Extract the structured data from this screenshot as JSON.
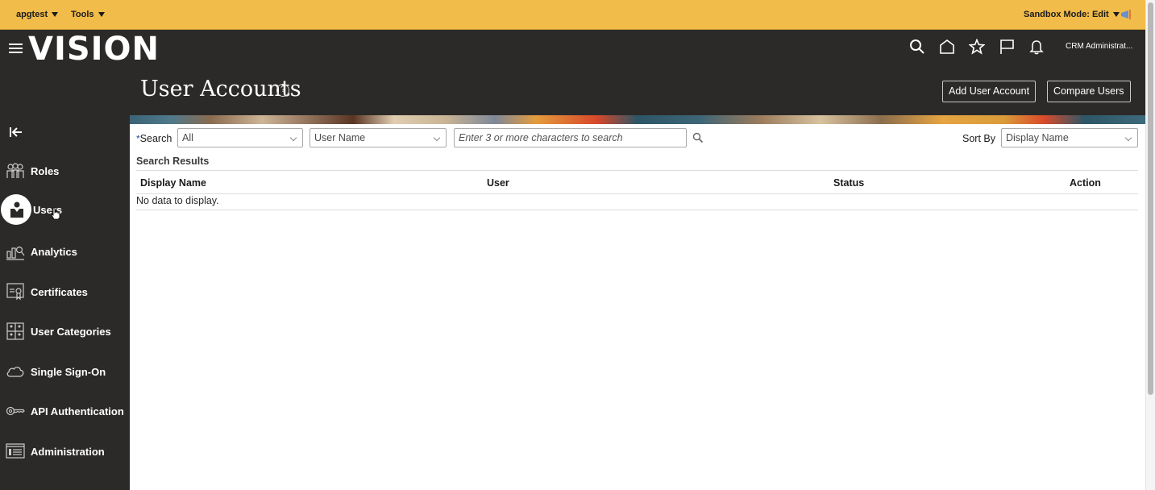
{
  "topbar": {
    "account_menu": "apgtest",
    "tools_menu": "Tools",
    "sandbox_mode": "Sandbox Mode: Edit"
  },
  "header": {
    "logo": "VISION",
    "user_menu": "CRM Administrat...",
    "icons": [
      "search-icon",
      "home-icon",
      "favorites-star-icon",
      "flag-icon",
      "notifications-bell-icon"
    ]
  },
  "page": {
    "title": "User Accounts",
    "help": "?",
    "add_user_account": "Add User Account",
    "compare_users": "Compare Users"
  },
  "sidebar": {
    "items": [
      {
        "label": "Roles",
        "icon": "roles-icon",
        "active": false
      },
      {
        "label": "Users",
        "icon": "user-icon",
        "active": true
      },
      {
        "label": "Analytics",
        "icon": "analytics-icon",
        "active": false
      },
      {
        "label": "Certificates",
        "icon": "certificate-icon",
        "active": false
      },
      {
        "label": "User Categories",
        "icon": "user-categories-icon",
        "active": false
      },
      {
        "label": "Single Sign-On",
        "icon": "cloud-icon",
        "active": false
      },
      {
        "label": "API Authentication",
        "icon": "key-icon",
        "active": false
      },
      {
        "label": "Administration",
        "icon": "administration-icon",
        "active": false
      }
    ]
  },
  "search": {
    "required_mark": "*",
    "label": "Search",
    "scope_value": "All",
    "field_value": "User Name",
    "input_value": "",
    "input_placeholder": "Enter 3 or more characters to search",
    "sort_by_label": "Sort By",
    "sort_by_value": "Display Name"
  },
  "results": {
    "title": "Search Results",
    "columns": [
      "Display Name",
      "User",
      "Status",
      "Action"
    ],
    "empty_message": "No data to display."
  },
  "colors": {
    "topbar": "#f2bc4a",
    "header": "#2c2a28",
    "required_mark": "#1f4d8f"
  }
}
